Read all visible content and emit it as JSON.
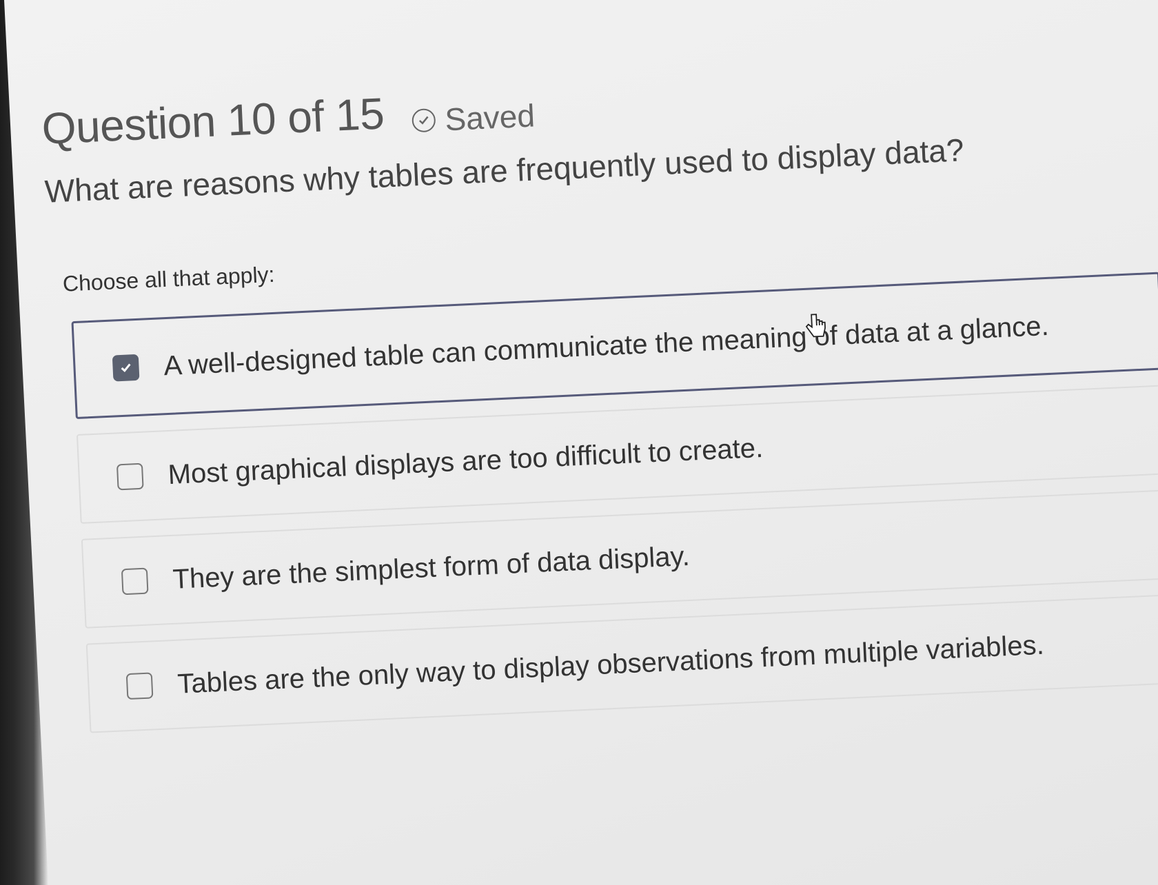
{
  "header": {
    "question_counter": "Question 10 of 15",
    "saved_label": "Saved",
    "saved_icon": "check-circle-icon"
  },
  "question": {
    "text": "What are reasons why tables are frequently used to display data?"
  },
  "instruction": "Choose all that apply:",
  "options": [
    {
      "label": "A well-designed table can communicate the meaning of data at a glance.",
      "checked": true
    },
    {
      "label": "Most graphical displays are too difficult to create.",
      "checked": false
    },
    {
      "label": "They are the simplest form of data display.",
      "checked": false
    },
    {
      "label": "Tables are the only way to display observations from multiple variables.",
      "checked": false
    }
  ],
  "colors": {
    "selected_border": "#565a7a",
    "checkbox_checked": "#5b6170",
    "text": "#333333"
  }
}
